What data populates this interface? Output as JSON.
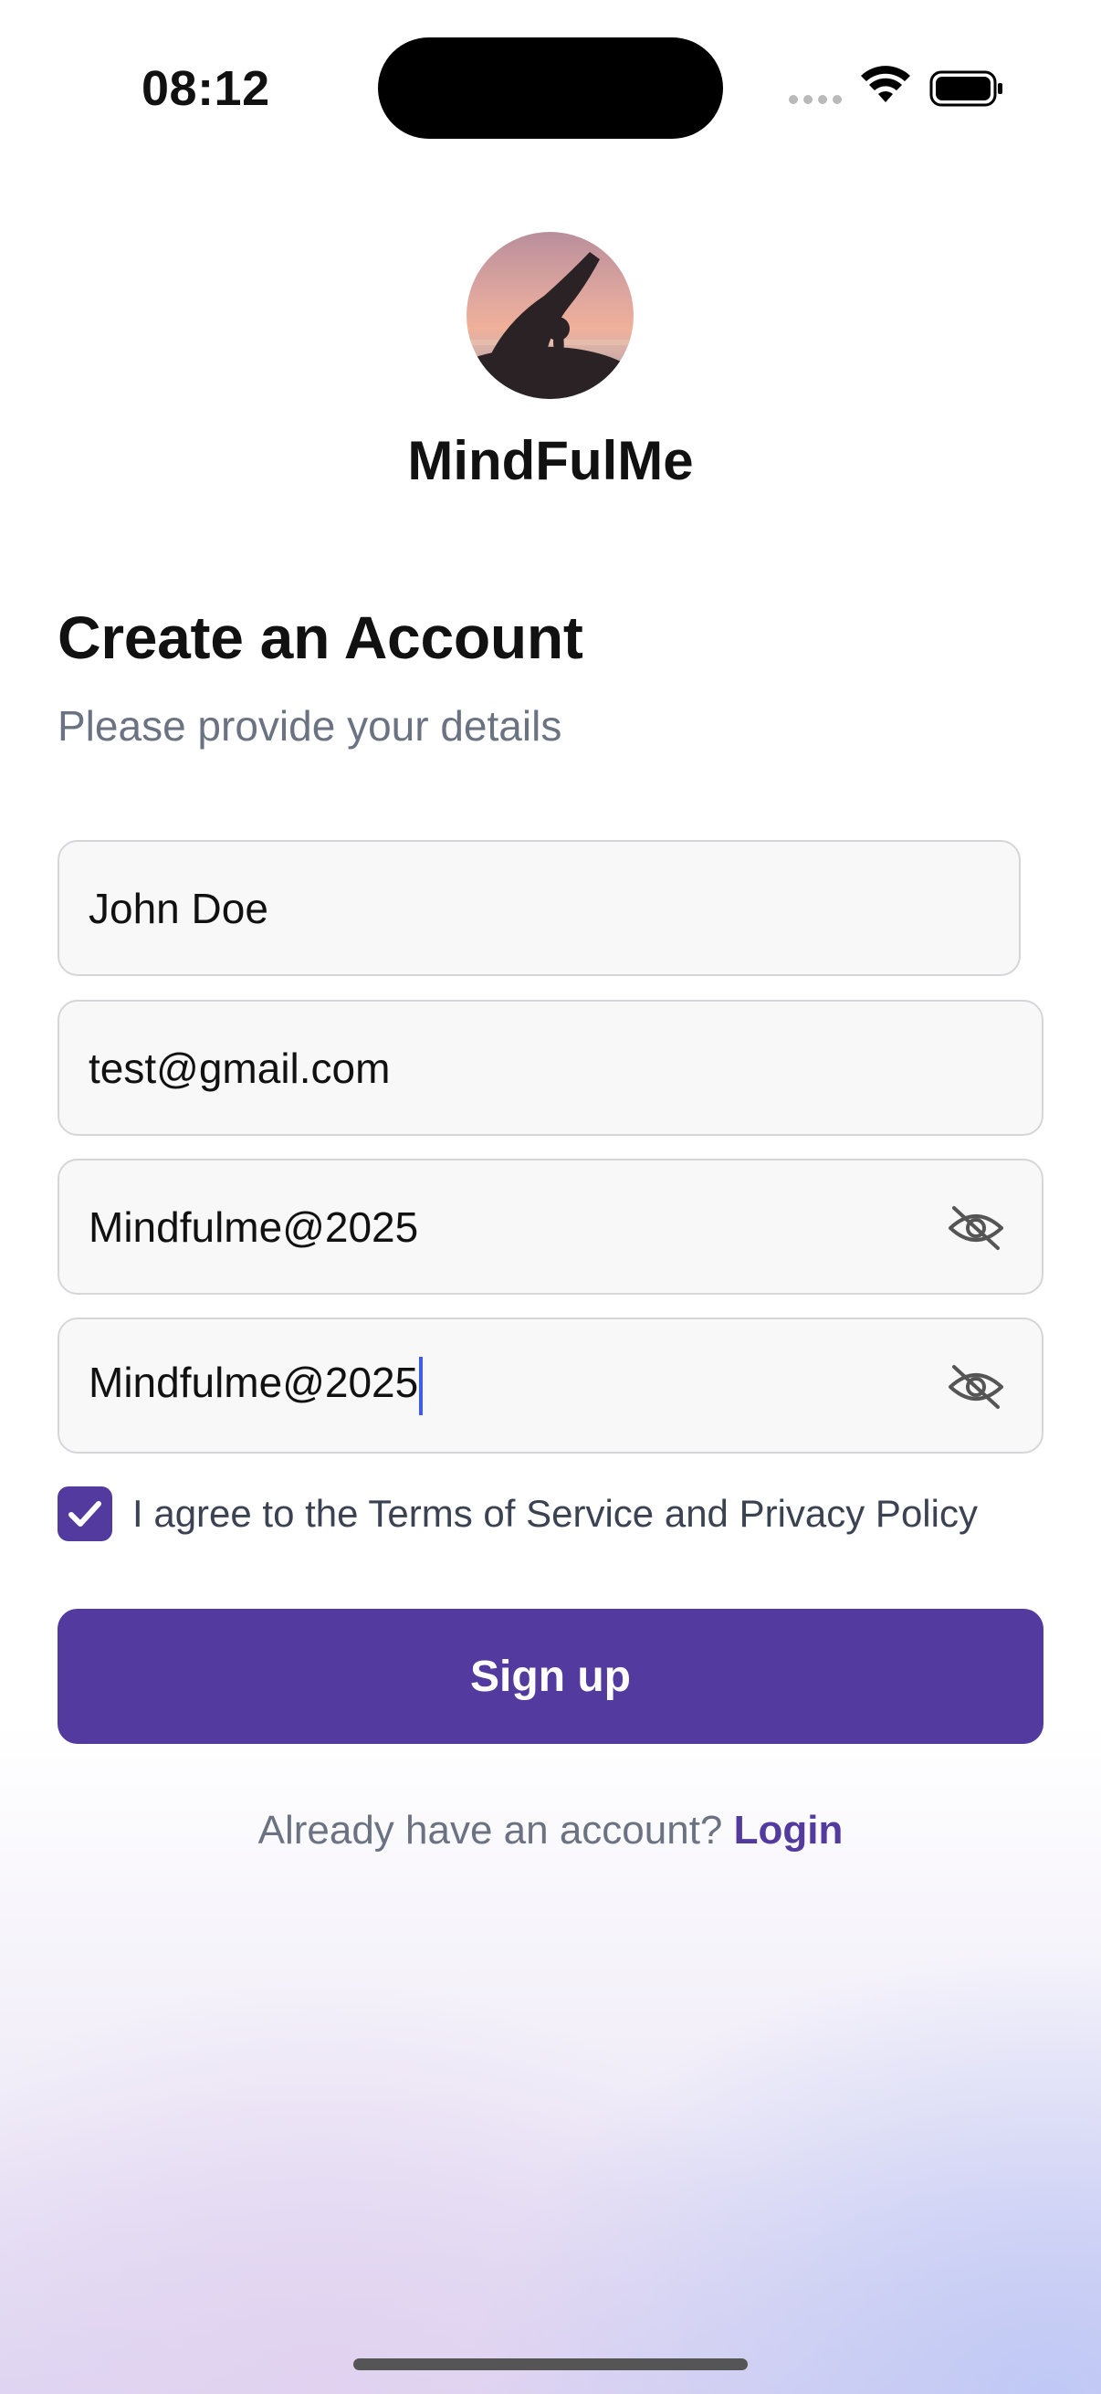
{
  "status_bar": {
    "time": "08:12",
    "icons": [
      "signal-dots-icon",
      "wifi-icon",
      "battery-icon"
    ]
  },
  "brand": {
    "name": "MindFulMe",
    "logo": "yoga-silhouette-sunset-avatar"
  },
  "form": {
    "title": "Create an Account",
    "subtitle": "Please provide your details",
    "full_name": {
      "value": "John Doe"
    },
    "email": {
      "value": "test@gmail.com"
    },
    "password": {
      "value": "Mindfulme@2025",
      "toggle_icon": "eye-off-icon"
    },
    "confirm_password": {
      "value": "Mindfulme@2025",
      "toggle_icon": "eye-off-icon",
      "focused": true
    },
    "agree": {
      "checked": true,
      "label": "I agree to the Terms of Service and Privacy Policy"
    },
    "submit_label": "Sign up",
    "login_prompt": "Already have an account?",
    "login_link": "Login"
  },
  "colors": {
    "accent": "#523a9e",
    "muted_text": "#6b7383",
    "field_bg": "#f8f8f9",
    "field_border": "#d6d6da",
    "caret": "#3b5bff"
  }
}
